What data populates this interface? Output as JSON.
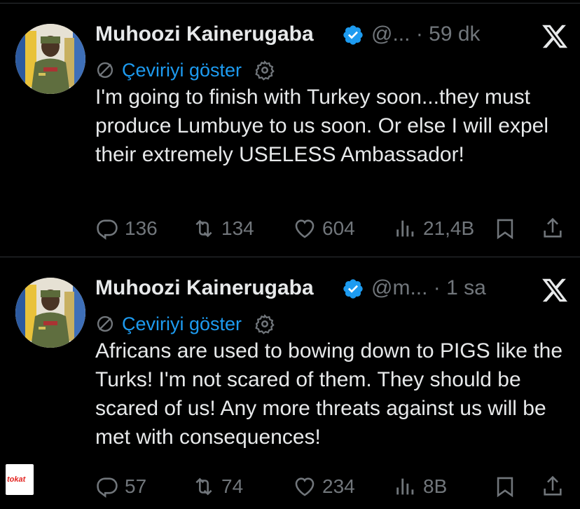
{
  "tweets": [
    {
      "author": "Muhoozi Kainerugaba",
      "handle": "@...",
      "separator": "·",
      "time": "59 dk",
      "translate_label": "Çeviriyi göster",
      "text": "I'm going to finish with Turkey soon...they must produce Lumbuye to us soon. Or else I will expel their extremely USELESS Ambassador!",
      "replies": "136",
      "reposts": "134",
      "likes": "604",
      "views": "21,4B"
    },
    {
      "author": "Muhoozi Kainerugaba",
      "handle": "@m...",
      "separator": "·",
      "time": "1 sa",
      "translate_label": "Çeviriyi göster",
      "text": "Africans are used to bowing down to PIGS like the Turks! I'm not scared of them. They should be scared of us! Any more threats against us will be met with consequences!",
      "replies": "57",
      "reposts": "74",
      "likes": "234",
      "views": "8B"
    }
  ],
  "watermark": {
    "text": "tokat"
  },
  "colors": {
    "background": "#000000",
    "text": "#e7e9ea",
    "muted": "#71767b",
    "accent": "#1d9bf0",
    "divider": "#2f3336"
  }
}
